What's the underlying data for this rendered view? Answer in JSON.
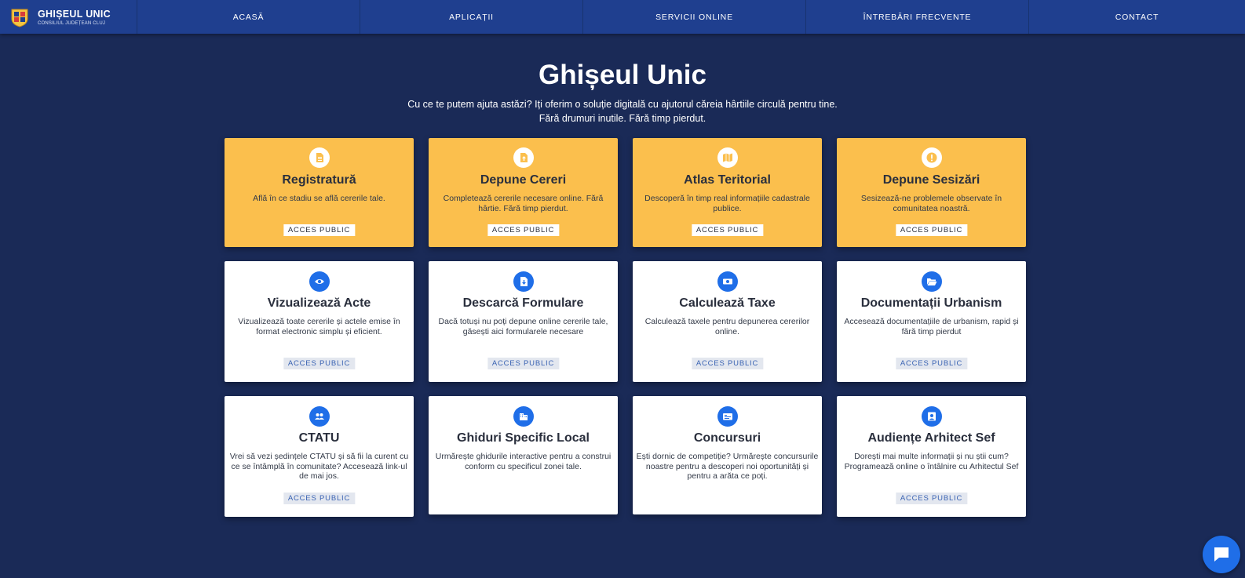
{
  "brand": {
    "title": "GHIȘEUL UNIC",
    "subtitle": "CONSILIUL JUDEȚEAN CLUJ"
  },
  "nav": [
    {
      "label": "ACASĂ"
    },
    {
      "label": "APLICAȚII"
    },
    {
      "label": "SERVICII ONLINE"
    },
    {
      "label": "ÎNTREBĂRI FRECVENTE"
    },
    {
      "label": "CONTACT"
    }
  ],
  "hero": {
    "title": "Ghișeul Unic",
    "line1": "Cu ce te putem ajuta astăzi? Iți oferim o soluție digitală cu ajutorul căreia hârtiile circulă pentru tine.",
    "line2": "Fără drumuri inutile. Fără timp pierdut."
  },
  "cards": [
    {
      "title": "Registratură",
      "desc": "Află în ce stadiu se află cererile tale.",
      "badge": "ACCES PUBLIC",
      "icon": "document-icon"
    },
    {
      "title": "Depune Cereri",
      "desc": "Completează cererile necesare online. Fără hârtie. Fără timp pierdut.",
      "badge": "ACCES PUBLIC",
      "icon": "file-upload-icon"
    },
    {
      "title": "Atlas Teritorial",
      "desc": "Descoperă în timp real informațiile cadastrale publice.",
      "badge": "ACCES PUBLIC",
      "icon": "map-icon"
    },
    {
      "title": "Depune Sesizări",
      "desc": "Sesizează-ne problemele observate în comunitatea noastră.",
      "badge": "ACCES PUBLIC",
      "icon": "exclamation-icon"
    },
    {
      "title": "Vizualizează Acte",
      "desc": "Vizualizează toate cererile și actele emise în format electronic simplu și eficient.",
      "badge": "ACCES PUBLIC",
      "icon": "eye-icon"
    },
    {
      "title": "Descarcă Formulare",
      "desc": "Dacă totuși nu poți depune online cererile tale, găsești aici formularele necesare",
      "badge": "ACCES PUBLIC",
      "icon": "file-download-icon"
    },
    {
      "title": "Calculează Taxe",
      "desc": "Calculează taxele pentru depunerea cererilor online.",
      "badge": "ACCES PUBLIC",
      "icon": "money-icon"
    },
    {
      "title": "Documentații Urbanism",
      "desc": "Accesează documentațiile de urbanism, rapid și fără timp pierdut",
      "badge": "ACCES PUBLIC",
      "icon": "folder-open-icon"
    },
    {
      "title": "CTATU",
      "desc": "Vrei să vezi ședințele CTATU și să fii la curent cu ce se întâmplă în comunitate? Accesează link-ul de mai jos.",
      "badge": "ACCES PUBLIC",
      "icon": "users-icon"
    },
    {
      "title": "Ghiduri Specific Local",
      "desc": "Urmărește ghidurile interactive pentru a construi conform cu specificul zonei tale.",
      "badge": "",
      "icon": "building-icon"
    },
    {
      "title": "Concursuri",
      "desc": "Ești dornic de competiție? Urmărește concursurile noastre pentru a descoperi noi oportunități și pentru a arăta ce poți.",
      "badge": "",
      "icon": "id-card-icon"
    },
    {
      "title": "Audiențe Arhitect Sef",
      "desc": "Dorești mai multe informații și nu știi cum? Programează online o întâlnire cu Arhitectul Sef",
      "badge": "ACCES PUBLIC",
      "icon": "user-icon"
    }
  ],
  "colors": {
    "background": "#1a2a57",
    "navbar": "#1f3f8f",
    "yellow_card": "#fbbf4d",
    "accent_blue": "#1f6ee8"
  }
}
